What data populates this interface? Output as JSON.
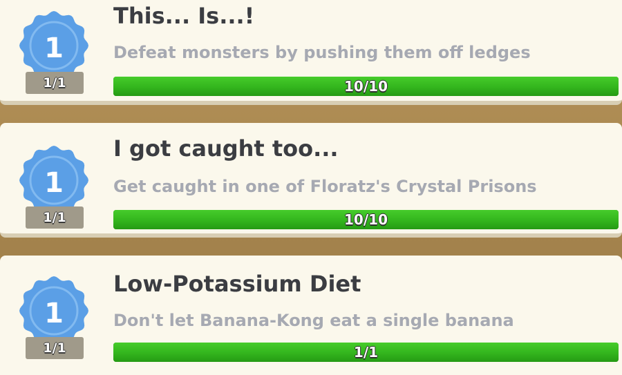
{
  "colors": {
    "badge_blue": "#5b9fe6",
    "badge_ring": "#8cc0f2",
    "progress_green": "#33b51d",
    "title_text": "#3b3d42",
    "description_text": "#a6a9b2",
    "background_wood": "#a7864f",
    "card_background": "#fbf8ec"
  },
  "achievements": [
    {
      "icon": "medal-badge-icon",
      "tier": "1",
      "tier_count": "1/1",
      "title": "This... Is...!",
      "description": "Defeat monsters by pushing them off ledges",
      "progress_text": "10/10",
      "progress_fraction": 1.0
    },
    {
      "icon": "medal-badge-icon",
      "tier": "1",
      "tier_count": "1/1",
      "title": "I got caught too...",
      "description": "Get caught in one of Floratz's Crystal Prisons",
      "progress_text": "10/10",
      "progress_fraction": 1.0
    },
    {
      "icon": "medal-badge-icon",
      "tier": "1",
      "tier_count": "1/1",
      "title": "Low-Potassium Diet",
      "description": "Don't let Banana-Kong eat a single banana",
      "progress_text": "1/1",
      "progress_fraction": 1.0
    }
  ]
}
